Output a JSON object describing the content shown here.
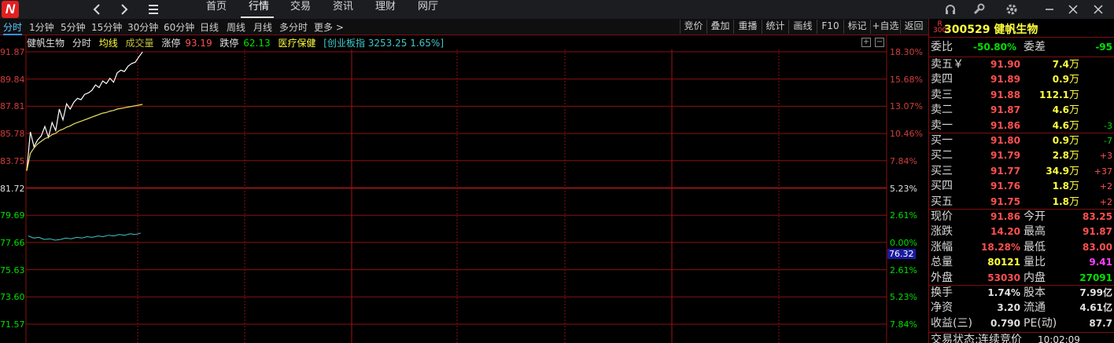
{
  "topbar": {
    "logo": "N",
    "menu": [
      "首页",
      "行情",
      "交易",
      "资讯",
      "理财",
      "网厅"
    ],
    "active": "行情"
  },
  "tabs": [
    "分时",
    "1分钟",
    "5分钟",
    "15分钟",
    "30分钟",
    "60分钟",
    "日线",
    "周线",
    "月线",
    "多分时",
    "更多 >"
  ],
  "active_tab": "分时",
  "tools": [
    "竞价",
    "叠加",
    "重播",
    "统计",
    "画线",
    "F10",
    "标记",
    "+自选",
    "返回"
  ],
  "chart_info": {
    "name": "健帆生物",
    "mode": "分时",
    "avg": "均线",
    "vol": "成交量",
    "up_limit_label": "涨停",
    "up_limit": "93.19",
    "down_limit_label": "跌停",
    "down_limit": "62.13",
    "sector": "医疗保健",
    "index": "[创业板指 3253.25 1.65%]"
  },
  "price_axis": [
    "91.87",
    "89.84",
    "87.81",
    "85.78",
    "83.75",
    "81.72",
    "79.69",
    "77.66",
    "75.63",
    "73.60",
    "71.57"
  ],
  "pct_axis": [
    "18.30%",
    "15.68%",
    "13.07%",
    "10.46%",
    "7.84%",
    "5.23%",
    "2.61%",
    "0.00%",
    "2.61%",
    "5.23%",
    "7.84%"
  ],
  "price_tag": "76.32",
  "chart_data": {
    "type": "line",
    "ylim": [
      71.57,
      91.87
    ],
    "prev_close": 77.66,
    "series": [
      {
        "values": [
          83.0,
          85.9,
          84.8,
          85.3,
          85.6,
          86.3,
          85.5,
          86.6,
          86.0,
          87.6,
          86.8,
          88.0,
          87.6,
          88.1,
          88.4,
          88.3,
          88.7,
          88.8,
          89.0,
          89.4,
          89.2,
          89.7,
          89.5,
          89.9,
          89.6,
          90.3,
          90.5,
          90.4,
          90.8,
          91.0,
          91.1,
          91.5,
          91.86
        ]
      },
      {
        "values": [
          83.0,
          84.3,
          84.7,
          85.0,
          85.2,
          85.4,
          85.5,
          85.7,
          85.8,
          86.0,
          86.1,
          86.25,
          86.35,
          86.5,
          86.6,
          86.7,
          86.8,
          86.9,
          87.0,
          87.1,
          87.2,
          87.3,
          87.35,
          87.45,
          87.5,
          87.6,
          87.65,
          87.7,
          87.75,
          87.8,
          87.85,
          87.9,
          87.95
        ]
      }
    ]
  },
  "quote": {
    "badge_r": "R",
    "badge_n": "300",
    "code_name": "300529 健帆生物",
    "webi_label": "委比",
    "webi": "-50.80%",
    "weicha_label": "委差",
    "weicha": "-95",
    "sell": [
      {
        "label": "卖五￥",
        "price": "91.90",
        "vol": "7.4",
        "unit": "万",
        "delta": ""
      },
      {
        "label": "卖四",
        "price": "91.89",
        "vol": "0.9",
        "unit": "万",
        "delta": ""
      },
      {
        "label": "卖三",
        "price": "91.88",
        "vol": "112.1",
        "unit": "万",
        "delta": ""
      },
      {
        "label": "卖二",
        "price": "91.87",
        "vol": "4.6",
        "unit": "万",
        "delta": ""
      },
      {
        "label": "卖一",
        "price": "91.86",
        "vol": "4.6",
        "unit": "万",
        "delta": "-3"
      }
    ],
    "buy": [
      {
        "label": "买一",
        "price": "91.80",
        "vol": "0.9",
        "unit": "万",
        "delta": "-7"
      },
      {
        "label": "买二",
        "price": "91.79",
        "vol": "2.8",
        "unit": "万",
        "delta": "+3"
      },
      {
        "label": "买三",
        "price": "91.77",
        "vol": "34.9",
        "unit": "万",
        "delta": "+37"
      },
      {
        "label": "买四",
        "price": "91.76",
        "vol": "1.8",
        "unit": "万",
        "delta": "+2"
      },
      {
        "label": "买五",
        "price": "91.75",
        "vol": "1.8",
        "unit": "万",
        "delta": "+2"
      }
    ],
    "stats1": [
      {
        "k": "现价",
        "v": "91.86",
        "k2": "今开",
        "v2": "83.25"
      },
      {
        "k": "涨跌",
        "v": "14.20",
        "k2": "最高",
        "v2": "91.87"
      },
      {
        "k": "涨幅",
        "v": "18.28%",
        "k2": "最低",
        "v2": "83.00"
      },
      {
        "k": "总量",
        "v": "80121",
        "k2": "量比",
        "v2": "9.41"
      },
      {
        "k": "外盘",
        "v": "53030",
        "k2": "内盘",
        "v2": "27091"
      }
    ],
    "stats2": [
      {
        "k": "换手",
        "v": "1.74%",
        "k2": "股本",
        "v2": "7.99亿"
      },
      {
        "k": "净资",
        "v": "3.20",
        "k2": "流通",
        "v2": "4.61亿"
      },
      {
        "k": "收益(三)",
        "v": "0.790",
        "k2": "PE(动)",
        "v2": "87.7"
      }
    ],
    "status_label": "交易状态:",
    "status": "连续竞价",
    "time": "10:02:09"
  },
  "colors": {
    "up": "#ff5050",
    "down": "#00e000",
    "grid": "#8b1010",
    "price_line": "#ffffff",
    "avg_line": "#e8e060",
    "vol_line": "#40c8c8"
  }
}
